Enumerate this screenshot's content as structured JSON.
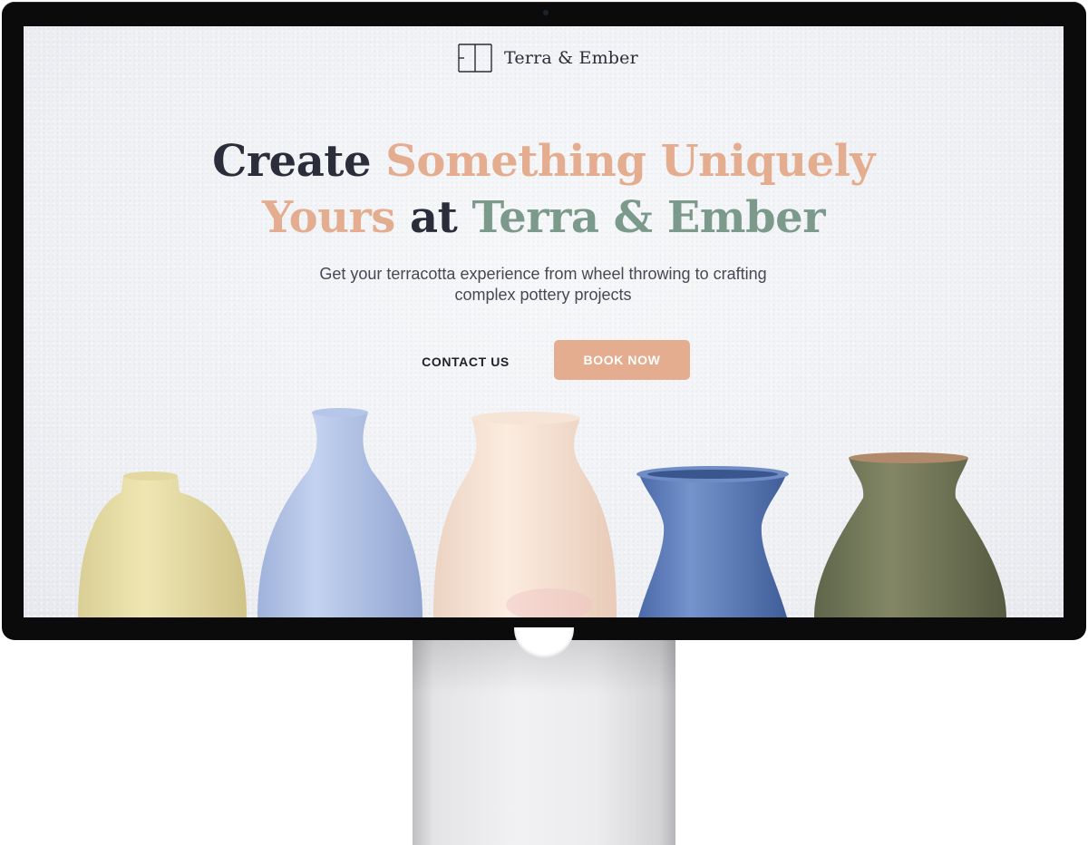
{
  "brand": {
    "name": "Terra & Ember"
  },
  "hero": {
    "headline": {
      "part1": "Create ",
      "part2": "Something Uniquely",
      "part3": "Yours",
      "part4": " at ",
      "part5": "Terra & Ember"
    },
    "subtitle_line1": "Get your terracotta experience from wheel throwing to crafting",
    "subtitle_line2": "complex pottery projects",
    "contact_label": "CONTACT US",
    "book_label": "BOOK NOW"
  },
  "colors": {
    "dark_text": "#2b2d3a",
    "accent_peach": "#e5ad8f",
    "accent_sage": "#7c9a8c",
    "bezel": "#0b0b0c"
  },
  "icons": {
    "logo": "terra-ember-logo-icon",
    "webcam": "webcam-icon"
  }
}
